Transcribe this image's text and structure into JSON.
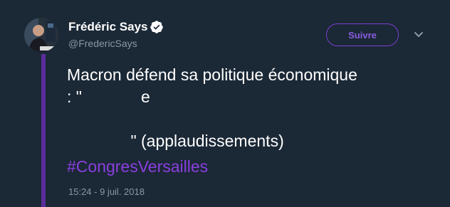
{
  "author": {
    "display_name": "Frédéric Says",
    "handle": "@FredericSays",
    "verified": true
  },
  "follow_button": {
    "label": "Suivre"
  },
  "tweet": {
    "text_lines": [
      "Macron défend sa politique économique",
      ": \"             e",
      "",
      "              \" (applaudissements)"
    ],
    "hashtag": "#CongresVersailles",
    "timestamp": "15:24 - 9 juil. 2018"
  },
  "colors": {
    "background": "#1b2836",
    "accent": "#7a3fd1",
    "thread_line": "#5b2c9b",
    "secondary_text": "#8899a6"
  },
  "icons": [
    "verified-badge-icon",
    "chevron-down-icon"
  ]
}
